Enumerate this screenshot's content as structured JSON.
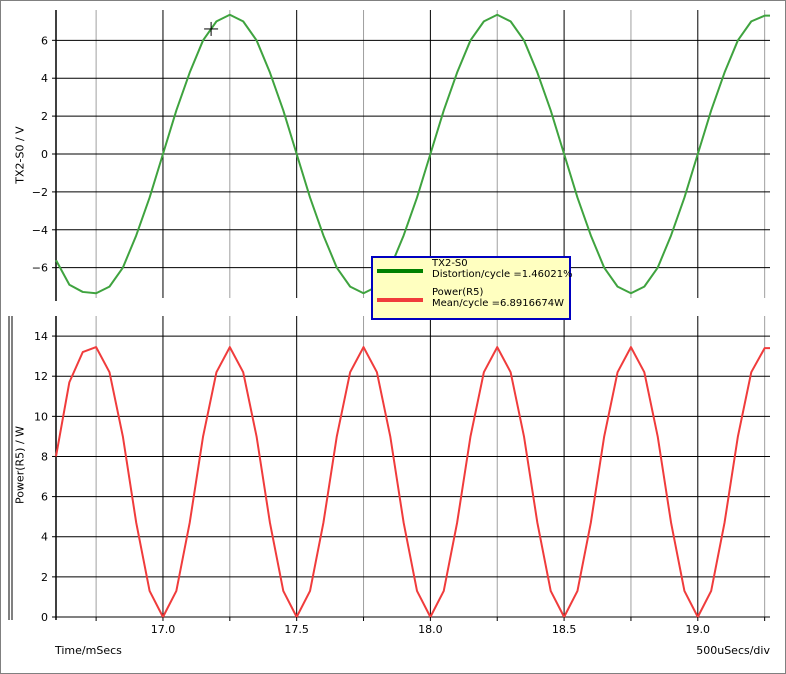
{
  "chart_data": [
    {
      "type": "line",
      "ylabel": "TX2-S0 / V",
      "ylim": [
        -7.6,
        7.6
      ],
      "xlim": [
        16.6,
        19.27
      ],
      "yticks": [
        -6,
        -4,
        -2,
        0,
        2,
        4,
        6
      ],
      "grid": true,
      "series": [
        {
          "name": "TX2-S0",
          "color": "#3fa33f",
          "x": [
            16.6,
            16.65,
            16.7,
            16.75,
            16.8,
            16.85,
            16.9,
            16.95,
            17.0,
            17.05,
            17.1,
            17.15,
            17.2,
            17.25,
            17.3,
            17.35,
            17.4,
            17.45,
            17.5,
            17.55,
            17.6,
            17.65,
            17.7,
            17.75,
            17.8,
            17.85,
            17.9,
            17.95,
            18.0,
            18.05,
            18.1,
            18.15,
            18.2,
            18.25,
            18.3,
            18.35,
            18.4,
            18.45,
            18.5,
            18.55,
            18.6,
            18.65,
            18.7,
            18.75,
            18.8,
            18.85,
            18.9,
            18.95,
            19.0,
            19.05,
            19.1,
            19.15,
            19.2,
            19.25,
            19.27
          ],
          "y": [
            -5.6,
            -6.9,
            -7.28,
            -7.35,
            -7.0,
            -6.0,
            -4.3,
            -2.3,
            0.0,
            2.3,
            4.3,
            6.0,
            7.0,
            7.35,
            7.0,
            6.0,
            4.3,
            2.3,
            0.0,
            -2.3,
            -4.3,
            -6.0,
            -7.0,
            -7.35,
            -7.0,
            -6.0,
            -4.3,
            -2.3,
            0.0,
            2.3,
            4.3,
            6.0,
            7.0,
            7.35,
            7.0,
            6.0,
            4.3,
            2.3,
            0.0,
            -2.3,
            -4.3,
            -6.0,
            -7.0,
            -7.35,
            -7.0,
            -6.0,
            -4.3,
            -2.3,
            0.0,
            2.3,
            4.3,
            6.0,
            7.0,
            7.3,
            7.3
          ]
        }
      ]
    },
    {
      "type": "line",
      "xlabel": "Time/mSecs",
      "ylabel": "Power(R5) / W",
      "ylim": [
        0,
        15
      ],
      "xlim": [
        16.6,
        19.27
      ],
      "xticks": [
        17.0,
        17.5,
        18.0,
        18.5,
        19.0
      ],
      "yticks": [
        0,
        2,
        4,
        6,
        8,
        10,
        12,
        14
      ],
      "grid": true,
      "series": [
        {
          "name": "Power(R5)",
          "color": "#f03c3c",
          "x": [
            16.6,
            16.65,
            16.7,
            16.75,
            16.8,
            16.85,
            16.9,
            16.95,
            17.0,
            17.05,
            17.1,
            17.15,
            17.2,
            17.25,
            17.3,
            17.35,
            17.4,
            17.45,
            17.5,
            17.55,
            17.6,
            17.65,
            17.7,
            17.75,
            17.8,
            17.85,
            17.9,
            17.95,
            18.0,
            18.05,
            18.1,
            18.15,
            18.2,
            18.25,
            18.3,
            18.35,
            18.4,
            18.45,
            18.5,
            18.55,
            18.6,
            18.65,
            18.7,
            18.75,
            18.8,
            18.85,
            18.9,
            18.95,
            19.0,
            19.05,
            19.1,
            19.15,
            19.2,
            19.25,
            19.27
          ],
          "y": [
            8.0,
            11.7,
            13.2,
            13.45,
            12.2,
            9.0,
            4.7,
            1.3,
            0.0,
            1.3,
            4.7,
            9.0,
            12.2,
            13.45,
            12.2,
            9.0,
            4.7,
            1.3,
            0.0,
            1.3,
            4.7,
            9.0,
            12.2,
            13.45,
            12.2,
            9.0,
            4.7,
            1.3,
            0.0,
            1.3,
            4.7,
            9.0,
            12.2,
            13.45,
            12.2,
            9.0,
            4.7,
            1.3,
            0.0,
            1.3,
            4.7,
            9.0,
            12.2,
            13.45,
            12.2,
            9.0,
            4.7,
            1.3,
            0.0,
            1.3,
            4.7,
            9.0,
            12.2,
            13.4,
            13.4
          ]
        }
      ]
    }
  ],
  "legend": {
    "entries": [
      {
        "name": "TX2-S0",
        "stat": "Distortion/cycle =1.46021%",
        "color": "#008000"
      },
      {
        "name": "Power(R5)",
        "stat": "Mean/cycle =6.8916674W",
        "color": "#f03c3c"
      }
    ]
  },
  "footer": {
    "x_label": "Time/mSecs",
    "scale_label": "500uSecs/div"
  },
  "cursor": {
    "x": 17.18,
    "y": 6.6
  }
}
